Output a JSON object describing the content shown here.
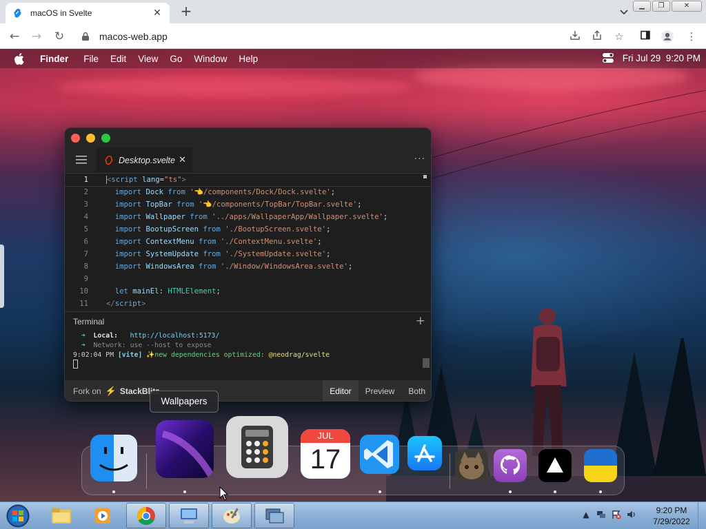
{
  "browser": {
    "tab_title": "macOS in Svelte",
    "url": "macos-web.app"
  },
  "menubar": {
    "app": "Finder",
    "items": [
      "File",
      "Edit",
      "View",
      "Go",
      "Window",
      "Help"
    ],
    "datetime": "Fri Jul 29  9:20 PM"
  },
  "editor": {
    "file_tab": "Desktop.svelte",
    "lines": [
      {
        "n": "1",
        "parts": [
          [
            "tag",
            "<"
          ],
          [
            "kw",
            "script"
          ],
          [
            "plain",
            " "
          ],
          [
            "id",
            "lang"
          ],
          [
            "plain",
            "="
          ],
          [
            "str",
            "\"ts\""
          ],
          [
            "tag",
            ">"
          ]
        ]
      },
      {
        "n": "2",
        "parts": [
          [
            "plain",
            "  "
          ],
          [
            "kw",
            "import"
          ],
          [
            "plain",
            " "
          ],
          [
            "id",
            "Dock"
          ],
          [
            "plain",
            " "
          ],
          [
            "kw",
            "from"
          ],
          [
            "plain",
            " "
          ],
          [
            "str",
            "'👈/components/Dock/Dock.svelte'"
          ],
          [
            "plain",
            ";"
          ]
        ]
      },
      {
        "n": "3",
        "parts": [
          [
            "plain",
            "  "
          ],
          [
            "kw",
            "import"
          ],
          [
            "plain",
            " "
          ],
          [
            "id",
            "TopBar"
          ],
          [
            "plain",
            " "
          ],
          [
            "kw",
            "from"
          ],
          [
            "plain",
            " "
          ],
          [
            "str",
            "'👈/components/TopBar/TopBar.svelte'"
          ],
          [
            "plain",
            ";"
          ]
        ]
      },
      {
        "n": "4",
        "parts": [
          [
            "plain",
            "  "
          ],
          [
            "kw",
            "import"
          ],
          [
            "plain",
            " "
          ],
          [
            "id",
            "Wallpaper"
          ],
          [
            "plain",
            " "
          ],
          [
            "kw",
            "from"
          ],
          [
            "plain",
            " "
          ],
          [
            "str",
            "'../apps/WallpaperApp/Wallpaper.svelte'"
          ],
          [
            "plain",
            ";"
          ]
        ]
      },
      {
        "n": "5",
        "parts": [
          [
            "plain",
            "  "
          ],
          [
            "kw",
            "import"
          ],
          [
            "plain",
            " "
          ],
          [
            "id",
            "BootupScreen"
          ],
          [
            "plain",
            " "
          ],
          [
            "kw",
            "from"
          ],
          [
            "plain",
            " "
          ],
          [
            "str",
            "'./BootupScreen.svelte'"
          ],
          [
            "plain",
            ";"
          ]
        ]
      },
      {
        "n": "6",
        "parts": [
          [
            "plain",
            "  "
          ],
          [
            "kw",
            "import"
          ],
          [
            "plain",
            " "
          ],
          [
            "id",
            "ContextMenu"
          ],
          [
            "plain",
            " "
          ],
          [
            "kw",
            "from"
          ],
          [
            "plain",
            " "
          ],
          [
            "str",
            "'./ContextMenu.svelte'"
          ],
          [
            "plain",
            ";"
          ]
        ]
      },
      {
        "n": "7",
        "parts": [
          [
            "plain",
            "  "
          ],
          [
            "kw",
            "import"
          ],
          [
            "plain",
            " "
          ],
          [
            "id",
            "SystemUpdate"
          ],
          [
            "plain",
            " "
          ],
          [
            "kw",
            "from"
          ],
          [
            "plain",
            " "
          ],
          [
            "str",
            "'./SystemUpdate.svelte'"
          ],
          [
            "plain",
            ";"
          ]
        ]
      },
      {
        "n": "8",
        "parts": [
          [
            "plain",
            "  "
          ],
          [
            "kw",
            "import"
          ],
          [
            "plain",
            " "
          ],
          [
            "id",
            "WindowsArea"
          ],
          [
            "plain",
            " "
          ],
          [
            "kw",
            "from"
          ],
          [
            "plain",
            " "
          ],
          [
            "str",
            "'./Window/WindowsArea.svelte'"
          ],
          [
            "plain",
            ";"
          ]
        ]
      },
      {
        "n": "9",
        "parts": []
      },
      {
        "n": "10",
        "parts": [
          [
            "plain",
            "  "
          ],
          [
            "kw",
            "let"
          ],
          [
            "plain",
            " "
          ],
          [
            "id",
            "mainEl"
          ],
          [
            "plain",
            ": "
          ],
          [
            "type",
            "HTMLElement"
          ],
          [
            "plain",
            ";"
          ]
        ]
      },
      {
        "n": "11",
        "parts": [
          [
            "tag",
            "</"
          ],
          [
            "kw",
            "script"
          ],
          [
            "tag",
            ">"
          ]
        ]
      }
    ],
    "terminal": {
      "title": "Terminal",
      "local_label": "Local:",
      "local_url": "http://localhost:5173/",
      "network_label": "Network:",
      "network_text": "use --host to expose",
      "log_time": "9:02:04 PM",
      "log_tag": "[vite]",
      "log_msg": "new dependencies optimized:",
      "log_pkg": "@neodrag/svelte"
    },
    "footer": {
      "fork_label": "Fork on",
      "brand": "StackBlitz",
      "views": [
        "Editor",
        "Preview",
        "Both"
      ],
      "active_view": "Editor"
    }
  },
  "tooltip": "Wallpapers",
  "calendar": {
    "month": "JUL",
    "day": "17"
  },
  "taskbar": {
    "time": "9:20 PM",
    "date": "7/29/2022"
  },
  "colors": {
    "menubar_text": "#ffffff",
    "editor_bg": "#1e1e1e",
    "svelte_orange": "#ff3e00",
    "stackblitz_blue": "#1389fd"
  }
}
